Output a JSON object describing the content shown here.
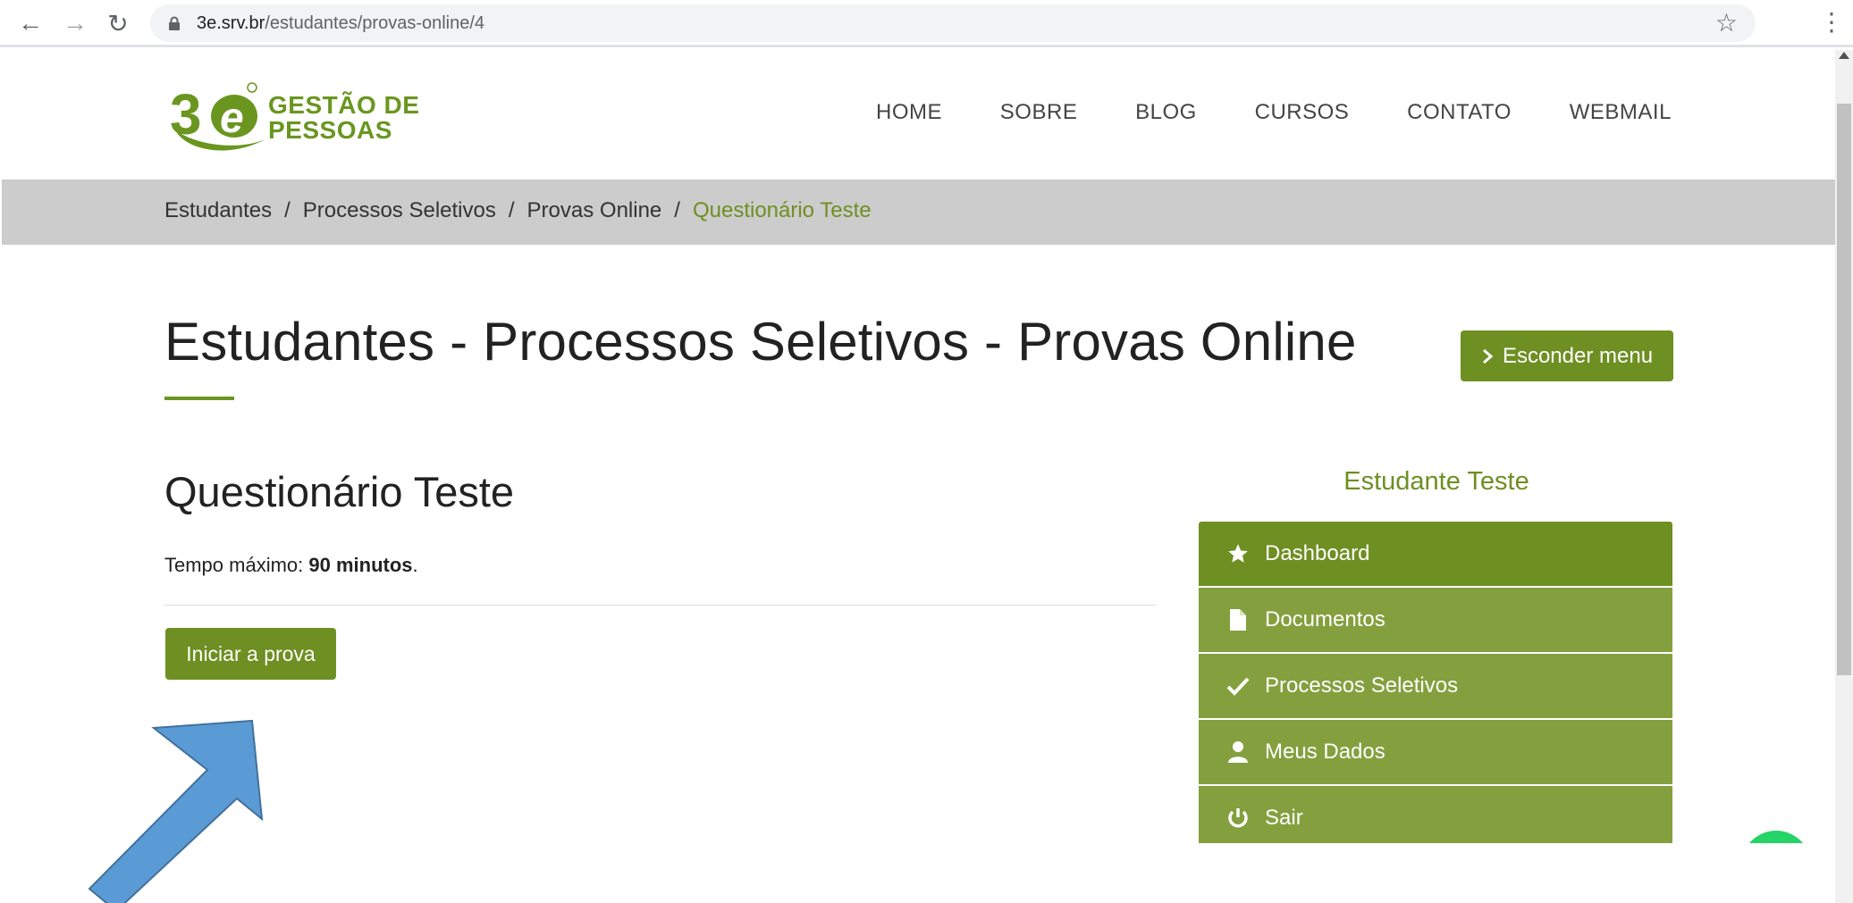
{
  "browser": {
    "url_host": "3e.srv.br",
    "url_path": "/estudantes/provas-online/4"
  },
  "site": {
    "logo_line1": "GESTÃO DE",
    "logo_line2": "PESSOAS",
    "nav": [
      "HOME",
      "SOBRE",
      "BLOG",
      "CURSOS",
      "CONTATO",
      "WEBMAIL"
    ]
  },
  "breadcrumb": {
    "items": [
      "Estudantes",
      "Processos Seletivos",
      "Provas Online"
    ],
    "separator": "/",
    "current": "Questionário Teste"
  },
  "page": {
    "title": "Estudantes - Processos Seletivos - Provas Online",
    "hide_menu_label": "Esconder menu"
  },
  "quiz": {
    "title": "Questionário Teste",
    "time_prefix": "Tempo máximo: ",
    "time_value": "90 minutos",
    "time_suffix": ".",
    "start_label": "Iniciar a prova"
  },
  "sidebar": {
    "student_name": "Estudante Teste",
    "items": [
      {
        "label": "Dashboard",
        "icon": "star-icon",
        "active": true
      },
      {
        "label": "Documentos",
        "icon": "document-icon",
        "active": false
      },
      {
        "label": "Processos Seletivos",
        "icon": "check-icon",
        "active": false
      },
      {
        "label": "Meus Dados",
        "icon": "user-icon",
        "active": false
      },
      {
        "label": "Sair",
        "icon": "power-icon",
        "active": false
      }
    ]
  },
  "colors": {
    "brand_green": "#6e8f22",
    "menu_green": "#84a03e",
    "breadcrumb_bg": "#cccccc",
    "arrow_blue": "#5b9bd5"
  }
}
